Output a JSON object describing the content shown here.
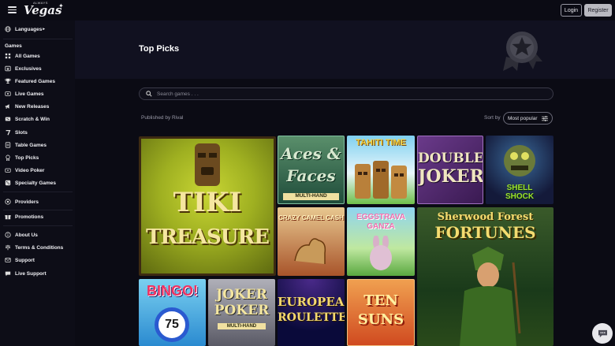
{
  "header": {
    "logo_small": "ALWAYS",
    "logo_big": "Vegas",
    "login_label": "Login",
    "register_label": "Register"
  },
  "sidebar": {
    "languages": "Languages",
    "languages_arrow": "▸",
    "games_heading": "Games",
    "game_items": [
      {
        "label": "All Games",
        "icon": "grid-icon"
      },
      {
        "label": "Exclusives",
        "icon": "star-box-icon"
      },
      {
        "label": "Featured Games",
        "icon": "trophy-icon"
      },
      {
        "label": "Live Games",
        "icon": "live-icon"
      },
      {
        "label": "New Releases",
        "icon": "megaphone-icon"
      },
      {
        "label": "Scratch & Win",
        "icon": "scratch-icon"
      },
      {
        "label": "Slots",
        "icon": "slots-icon"
      },
      {
        "label": "Table Games",
        "icon": "table-icon"
      },
      {
        "label": "Top Picks",
        "icon": "award-icon"
      },
      {
        "label": "Video Poker",
        "icon": "cards-icon"
      },
      {
        "label": "Specialty Games",
        "icon": "dice-icon"
      }
    ],
    "providers": "Providers",
    "promotions": "Promotions",
    "about_us": "About Us",
    "terms": "Terms & Conditions",
    "support": "Support",
    "live_support": "Live Support"
  },
  "hero": {
    "title": "Top Picks"
  },
  "search": {
    "placeholder": "Search games . . ."
  },
  "filters": {
    "publisher": "Published by Rival",
    "sort_label": "Sort by",
    "sort_value": "Most popular"
  },
  "games": [
    {
      "title_line1": "TIKI",
      "title_line2": "TREASURE"
    },
    {
      "title_line1": "Aces &",
      "title_line2": "Faces",
      "tag": "MULTI-HAND"
    },
    {
      "title_line1": "TAHITI TIME"
    },
    {
      "title_line1": "DOUBLE",
      "title_line2": "JOKER"
    },
    {
      "title_line1": "SHELL",
      "title_line2": "SHOCK"
    },
    {
      "title_line1": "CRAZY CAMEL CASH"
    },
    {
      "title_line1": "EGGSTRAVA",
      "title_line2": "GANZA"
    },
    {
      "title_line1": "Sherwood Forest",
      "title_line2": "FORTUNES"
    },
    {
      "title_line1": "BINGO!",
      "title_line2": "75"
    },
    {
      "title_line1": "JOKER",
      "title_line2": "POKER",
      "tag": "MULTI-HAND"
    },
    {
      "title_line1": "EUROPEAN",
      "title_line2": "ROULETTE"
    },
    {
      "title_line1": "TEN",
      "title_line2": "SUNS"
    }
  ],
  "colors": {
    "page_bg": "#0b0b14",
    "sidebar_bg": "#0d0d17",
    "hero_bg": "#111120"
  }
}
